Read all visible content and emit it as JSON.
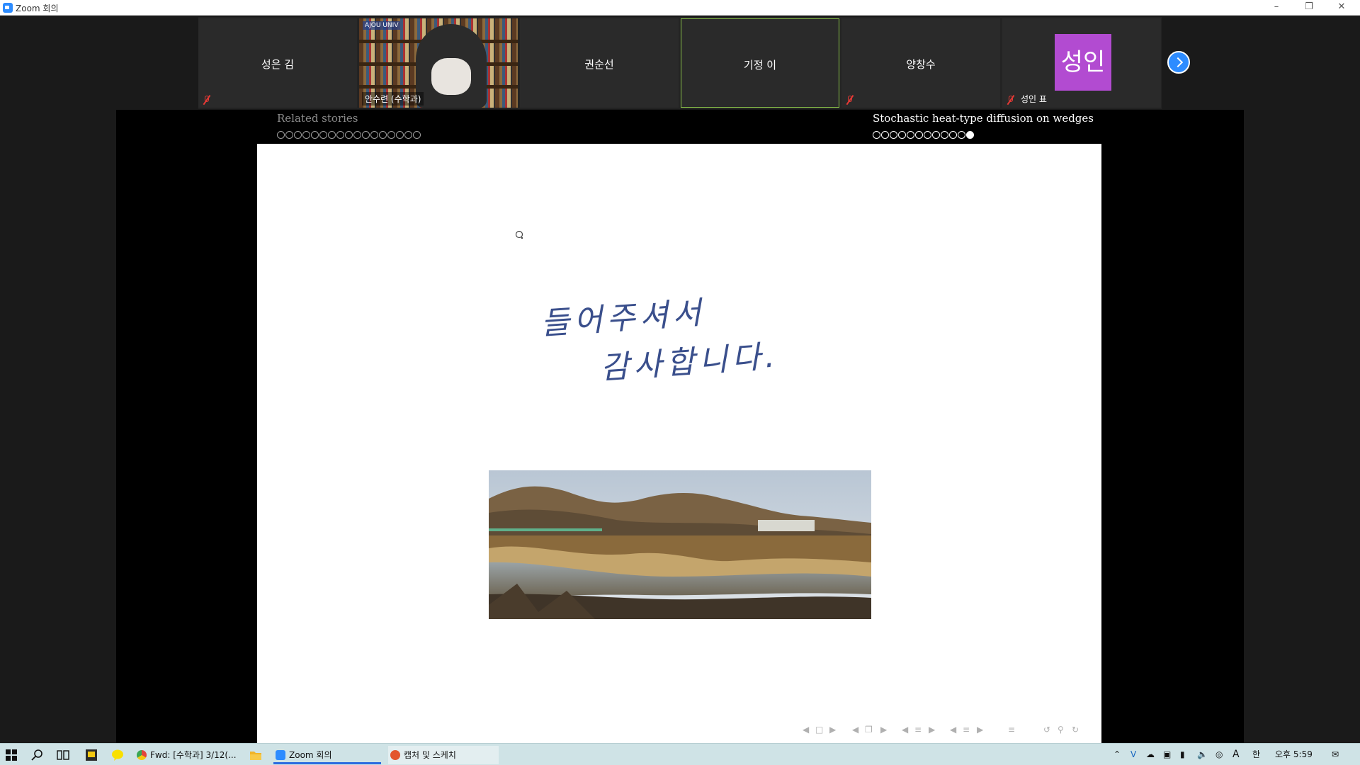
{
  "window": {
    "title": "Zoom 회의"
  },
  "participants": [
    {
      "name": "성은 김",
      "muted": true,
      "active": false
    },
    {
      "name": "안수련 (수학과)",
      "muted": false,
      "active": false,
      "video": true,
      "logo": "AJOU UNIV"
    },
    {
      "name": "권순선",
      "muted": false,
      "active": false
    },
    {
      "name": "기정 이",
      "muted": false,
      "active": true
    },
    {
      "name": "양창수",
      "muted": true,
      "active": false
    },
    {
      "name": "성인 표",
      "muted": true,
      "active": false,
      "avatar_text": "성인",
      "avatar_color": "#b24bd1"
    }
  ],
  "slide": {
    "left_section": "Related stories",
    "left_dots": 17,
    "right_section": "Stochastic heat-type diffusion on wedges",
    "right_dots": 12,
    "right_filled_index": 11,
    "handwriting_line1": "들어주셔서",
    "handwriting_line2": "감사합니다."
  },
  "taskbar": {
    "items": [
      {
        "label": "Fwd: [수학과] 3/12(...",
        "icon_color": "#e2453c"
      },
      {
        "label": "Zoom 회의",
        "icon_color": "#2d8cff"
      },
      {
        "label": "캡처 및 스케치",
        "icon_color": "#e3572e"
      }
    ],
    "ime": "한",
    "font_indicator": "A",
    "clock": "오후 5:59"
  },
  "colors": {
    "accent": "#2d8cff",
    "muted_mic": "#e53935",
    "active_speaker": "#8bc34a"
  }
}
